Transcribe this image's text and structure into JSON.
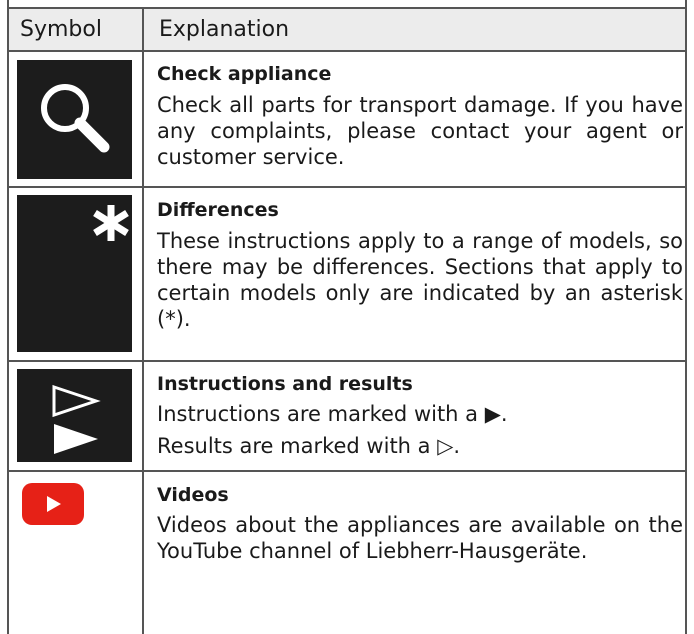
{
  "table": {
    "header": {
      "symbol": "Symbol",
      "explanation": "Explanation"
    },
    "rows": [
      {
        "icon": "magnifier-icon",
        "title": "Check appliance",
        "text": "Check all parts for transport damage. If you have any complaints, please contact your agent or customer service."
      },
      {
        "icon": "asterisk-icon",
        "title": "Differences",
        "text": "These instructions apply to a range of models, so there may be differences. Sections that apply to certain models only are indicated by an asterisk (*)."
      },
      {
        "icon": "triangle-arrows-icon",
        "title": "Instructions and results",
        "instructions_text": "Instructions are marked with a",
        "instructions_symbol": "▶",
        "results_text": "Results are marked with a",
        "results_symbol": "▷",
        "period": "."
      },
      {
        "icon": "youtube-play-icon",
        "title": "Videos",
        "text": "Videos about the appliances are available on the YouTube channel of Liebherr-Hausgeräte."
      }
    ]
  },
  "colors": {
    "icon_background": "#1c1c1c",
    "header_background": "#ececec",
    "youtube_red": "#e62117",
    "border": "#555555"
  }
}
